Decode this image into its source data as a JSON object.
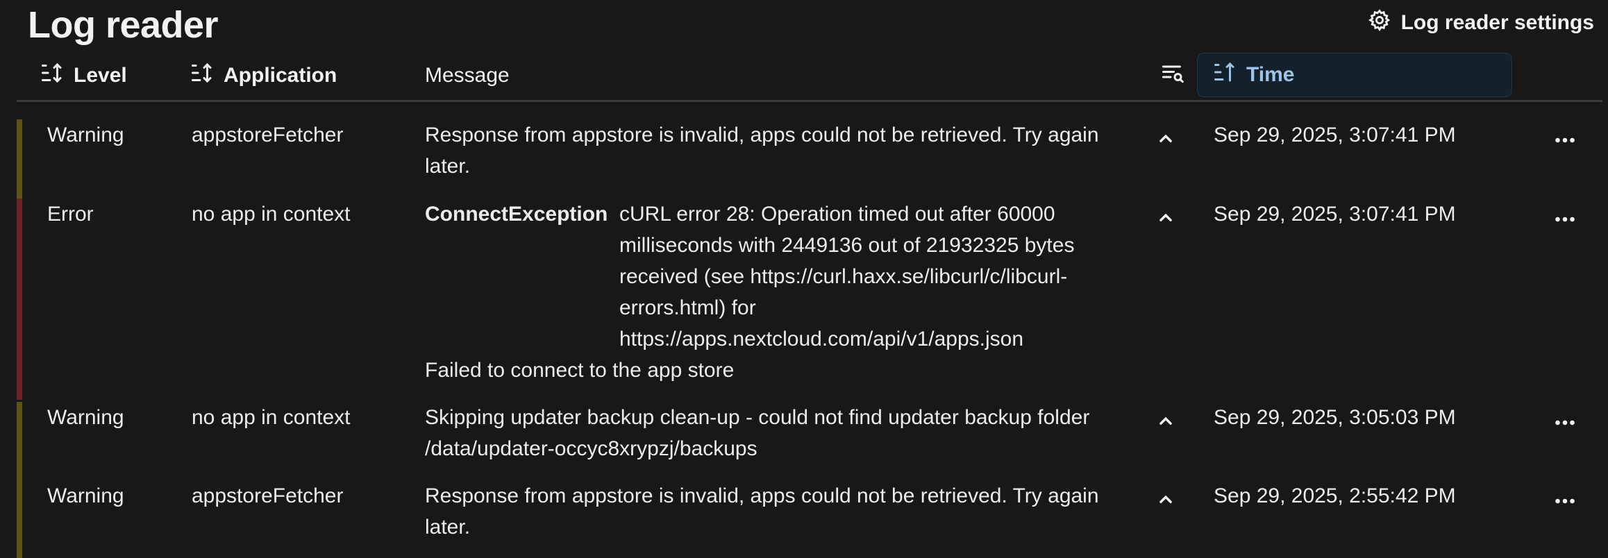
{
  "page": {
    "title": "Log reader"
  },
  "settings": {
    "label": "Log reader settings",
    "icon": "gear-icon"
  },
  "columns": {
    "level": "Level",
    "application": "Application",
    "message": "Message",
    "time": "Time"
  },
  "rows": [
    {
      "level": "Warning",
      "application": "appstoreFetcher",
      "message": "Response from appstore is invalid, apps could not be retrieved. Try again later.",
      "time": "Sep 29, 2025, 3:07:41 PM"
    },
    {
      "level": "Error",
      "application": "no app in context",
      "exception_name": "ConnectException",
      "exception_text": "cURL error 28: Operation timed out after 60000 milliseconds with 2449136 out of 21932325 bytes received (see https://curl.haxx.se/libcurl/c/libcurl-errors.html) for https://apps.nextcloud.com/api/v1/apps.json",
      "message": "Failed to connect to the app store",
      "time": "Sep 29, 2025, 3:07:41 PM"
    },
    {
      "level": "Warning",
      "application": "no app in context",
      "message": "Skipping updater backup clean-up - could not find updater backup folder /data/updater-occyc8xrypzj/backups",
      "time": "Sep 29, 2025, 3:05:03 PM"
    },
    {
      "level": "Warning",
      "application": "appstoreFetcher",
      "message": "Response from appstore is invalid, apps could not be retrieved. Try again later.",
      "time": "Sep 29, 2025, 2:55:42 PM"
    }
  ],
  "colors": {
    "warning": "#5c5318",
    "error": "#6b2326",
    "active_sort": "#9dc3e6"
  }
}
